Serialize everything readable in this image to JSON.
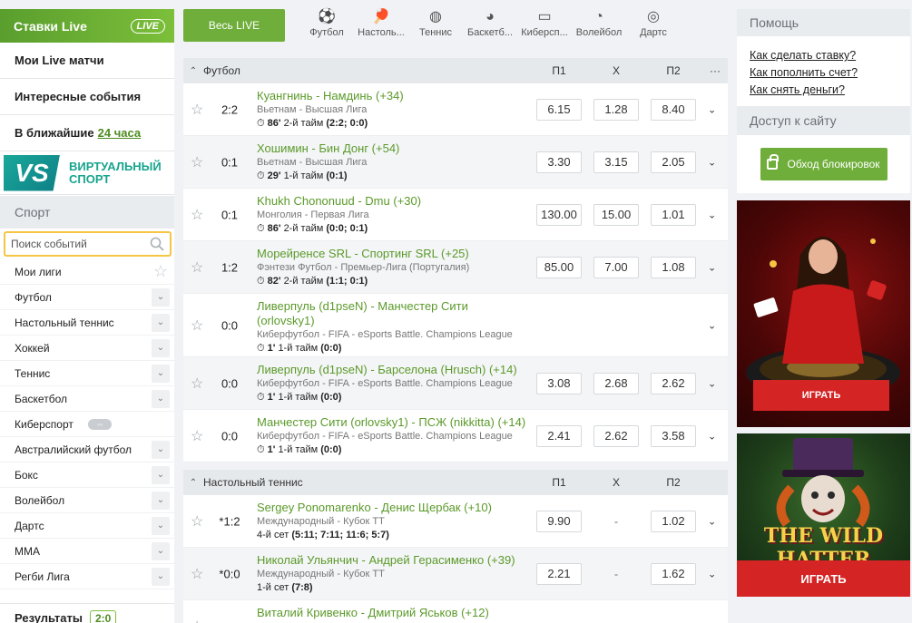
{
  "left": {
    "live_header": "Ставки Live",
    "live_logo": "LIVE",
    "menu": [
      {
        "label": "Мои Live матчи"
      },
      {
        "label": "Интересные события"
      }
    ],
    "nearest_prefix": "В ближайшие",
    "nearest_link": "24 часа",
    "vs_badge": "VS",
    "vs_text_1": "ВИРТУАЛЬНЫЙ",
    "vs_text_2": "СПОРТ",
    "sport_head": "Спорт",
    "search_placeholder": "Поиск событий",
    "my_leagues": "Мои лиги",
    "sports": [
      "Футбол",
      "Настольный теннис",
      "Хоккей",
      "Теннис",
      "Баскетбол",
      "Киберспорт",
      "Австралийский футбол",
      "Бокс",
      "Волейбол",
      "Дартс",
      "MMA",
      "Регби Лига"
    ],
    "results_label": "Результаты",
    "results_score": "2:0"
  },
  "topnav": {
    "all_live": "Весь LIVE",
    "tabs": [
      {
        "label": "Футбол",
        "icon": "⚽"
      },
      {
        "label": "Настоль...",
        "icon": "🏓"
      },
      {
        "label": "Теннис",
        "icon": "◍"
      },
      {
        "label": "Баскетб...",
        "icon": "◕"
      },
      {
        "label": "Киберсп...",
        "icon": "▭"
      },
      {
        "label": "Волейбол",
        "icon": "◔"
      },
      {
        "label": "Дартс",
        "icon": "◎"
      }
    ]
  },
  "groups": [
    {
      "name": "Футбол",
      "cols": [
        "П1",
        "X",
        "П2"
      ],
      "more": "···",
      "events": [
        {
          "score": "2:2",
          "title": "Куангнинь - Намдинь (+34)",
          "league": "Вьетнам - Высшая Лига",
          "minute": "86'",
          "period": "2-й тайм",
          "detail": "(2:2; 0:0)",
          "p1": "6.15",
          "x": "1.28",
          "p2": "8.40"
        },
        {
          "score": "0:1",
          "title": "Хошимин - Бин Донг (+54)",
          "league": "Вьетнам - Высшая Лига",
          "minute": "29'",
          "period": "1-й тайм",
          "detail": "(0:1)",
          "p1": "3.30",
          "x": "3.15",
          "p2": "2.05"
        },
        {
          "score": "0:1",
          "title": "Khukh Chononuud - Dmu (+30)",
          "league": "Монголия - Первая Лига",
          "minute": "86'",
          "period": "2-й тайм",
          "detail": "(0:0; 0:1)",
          "p1": "130.00",
          "x": "15.00",
          "p2": "1.01"
        },
        {
          "score": "1:2",
          "title": "Морейренсе SRL - Спортинг SRL (+25)",
          "league": "Фэнтези Футбол - Премьер-Лига (Португалия)",
          "minute": "82'",
          "period": "2-й тайм",
          "detail": "(1:1; 0:1)",
          "p1": "85.00",
          "x": "7.00",
          "p2": "1.08"
        },
        {
          "score": "0:0",
          "title": "Ливерпуль (d1pseN) - Манчестер Сити (orlovsky1)",
          "league": "Киберфутбол - FIFA - eSports Battle. Champions League",
          "minute": "1'",
          "period": "1-й тайм",
          "detail": "(0:0)",
          "p1": "",
          "x": "",
          "p2": ""
        },
        {
          "score": "0:0",
          "title": "Ливерпуль (d1pseN) - Барселона (Hrusch) (+14)",
          "league": "Киберфутбол - FIFA - eSports Battle. Champions League",
          "minute": "1'",
          "period": "1-й тайм",
          "detail": "(0:0)",
          "p1": "3.08",
          "x": "2.68",
          "p2": "2.62"
        },
        {
          "score": "0:0",
          "title": "Манчестер Сити (orlovsky1) - ПСЖ (nikkitta) (+14)",
          "league": "Киберфутбол - FIFA - eSports Battle. Champions League",
          "minute": "1'",
          "period": "1-й тайм",
          "detail": "(0:0)",
          "p1": "2.41",
          "x": "2.62",
          "p2": "3.58"
        }
      ]
    },
    {
      "name": "Настольный теннис",
      "cols": [
        "П1",
        "X",
        "П2"
      ],
      "more": "",
      "events": [
        {
          "score": "*1:2",
          "title": "Sergey Ponomarenko - Денис Щербак (+10)",
          "league": "Международный - Кубок ТТ",
          "minute": "",
          "period": "4-й сет",
          "detail": "(5:11; 7:11; 11:6; 5:7)",
          "p1": "9.90",
          "x": "-",
          "p2": "1.02"
        },
        {
          "score": "*0:0",
          "title": "Николай Ульянчич - Андрей Герасименко (+39)",
          "league": "Международный - Кубок ТТ",
          "minute": "",
          "period": "1-й сет",
          "detail": "(7:8)",
          "p1": "2.21",
          "x": "-",
          "p2": "1.62"
        },
        {
          "score": "",
          "title": "Виталий Кривенко - Дмитрий Яськов (+12)",
          "league": "",
          "minute": "",
          "period": "",
          "detail": "",
          "p1": "",
          "x": "",
          "p2": ""
        }
      ]
    }
  ],
  "right": {
    "help_head": "Помощь",
    "help_links": [
      "Как сделать ставку?",
      "Как пополнить счет?",
      "Как снять деньги?"
    ],
    "access_head": "Доступ к сайту",
    "bypass": "Обход блокировок",
    "play1": "ИГРАТЬ",
    "wild_title": "THE WILD HATTER",
    "play2": "ИГРАТЬ"
  },
  "colors": {
    "accent_green": "#6fae3a",
    "link_green": "#5b9a2a",
    "play_red": "#d42424"
  }
}
